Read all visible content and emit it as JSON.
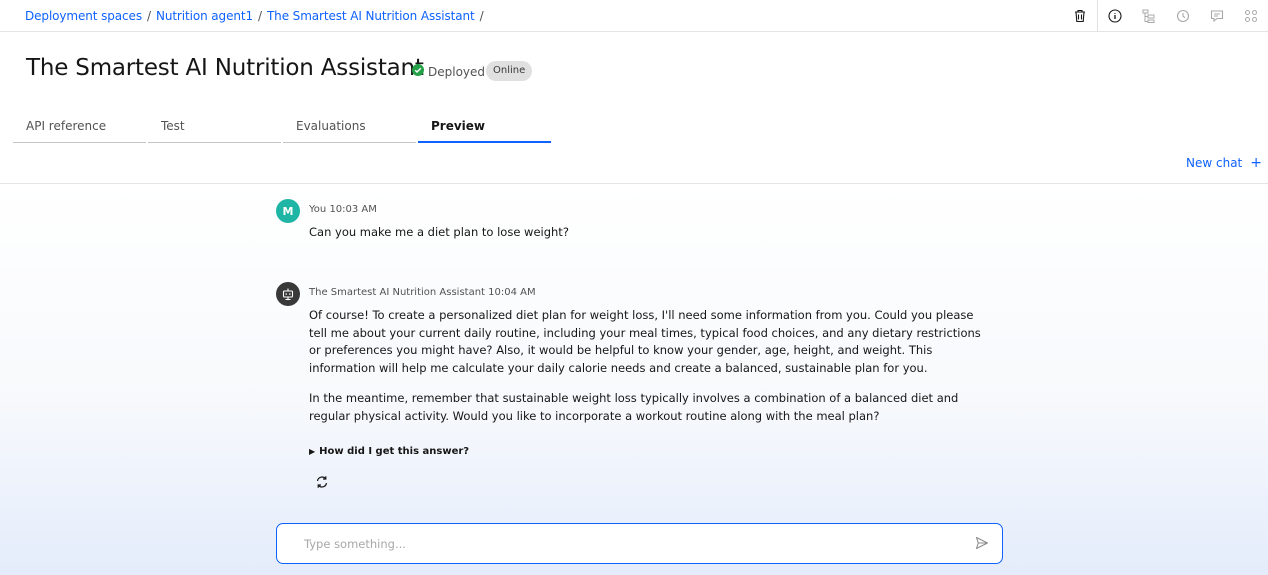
{
  "breadcrumb": [
    {
      "label": "Deployment spaces"
    },
    {
      "label": "Nutrition agent1"
    },
    {
      "label": "The Smartest AI Nutrition Assistant"
    }
  ],
  "breadcrumb_separator": "/",
  "top_icons": [
    "trash-icon",
    "info-icon",
    "flow-icon",
    "history-icon",
    "comment-icon",
    "grid-icon"
  ],
  "page": {
    "title": "The Smartest AI Nutrition Assistant",
    "status_label": "Deployed",
    "status_tag": "Online"
  },
  "tabs": [
    {
      "label": "API reference",
      "active": false
    },
    {
      "label": "Test",
      "active": false
    },
    {
      "label": "Evaluations",
      "active": false
    },
    {
      "label": "Preview",
      "active": true
    }
  ],
  "new_chat": {
    "label": "New chat",
    "icon": "+"
  },
  "messages": [
    {
      "sender": "You",
      "time": "10:03 AM",
      "avatar_initial": "M",
      "text": "Can you make me a diet plan to lose weight?"
    },
    {
      "sender": "The Smartest AI Nutrition Assistant",
      "time": "10:04 AM",
      "paragraphs": [
        "Of course! To create a personalized diet plan for weight loss, I'll need some information from you. Could you please tell me about your current daily routine, including your meal times, typical food choices, and any dietary restrictions or preferences you might have? Also, it would be helpful to know your gender, age, height, and weight. This information will help me calculate your daily calorie needs and create a balanced, sustainable plan for you.",
        "In the meantime, remember that sustainable weight loss typically involves a combination of a balanced diet and regular physical activity. Would you like to incorporate a workout routine along with the meal plan?"
      ],
      "explain_label": "How did I get this answer?"
    }
  ],
  "composer": {
    "placeholder": "Type something...",
    "value": ""
  },
  "colors": {
    "accent": "#0f62fe",
    "user_avatar": "#1fb5a5",
    "bot_avatar": "#393939",
    "success": "#24a148"
  }
}
